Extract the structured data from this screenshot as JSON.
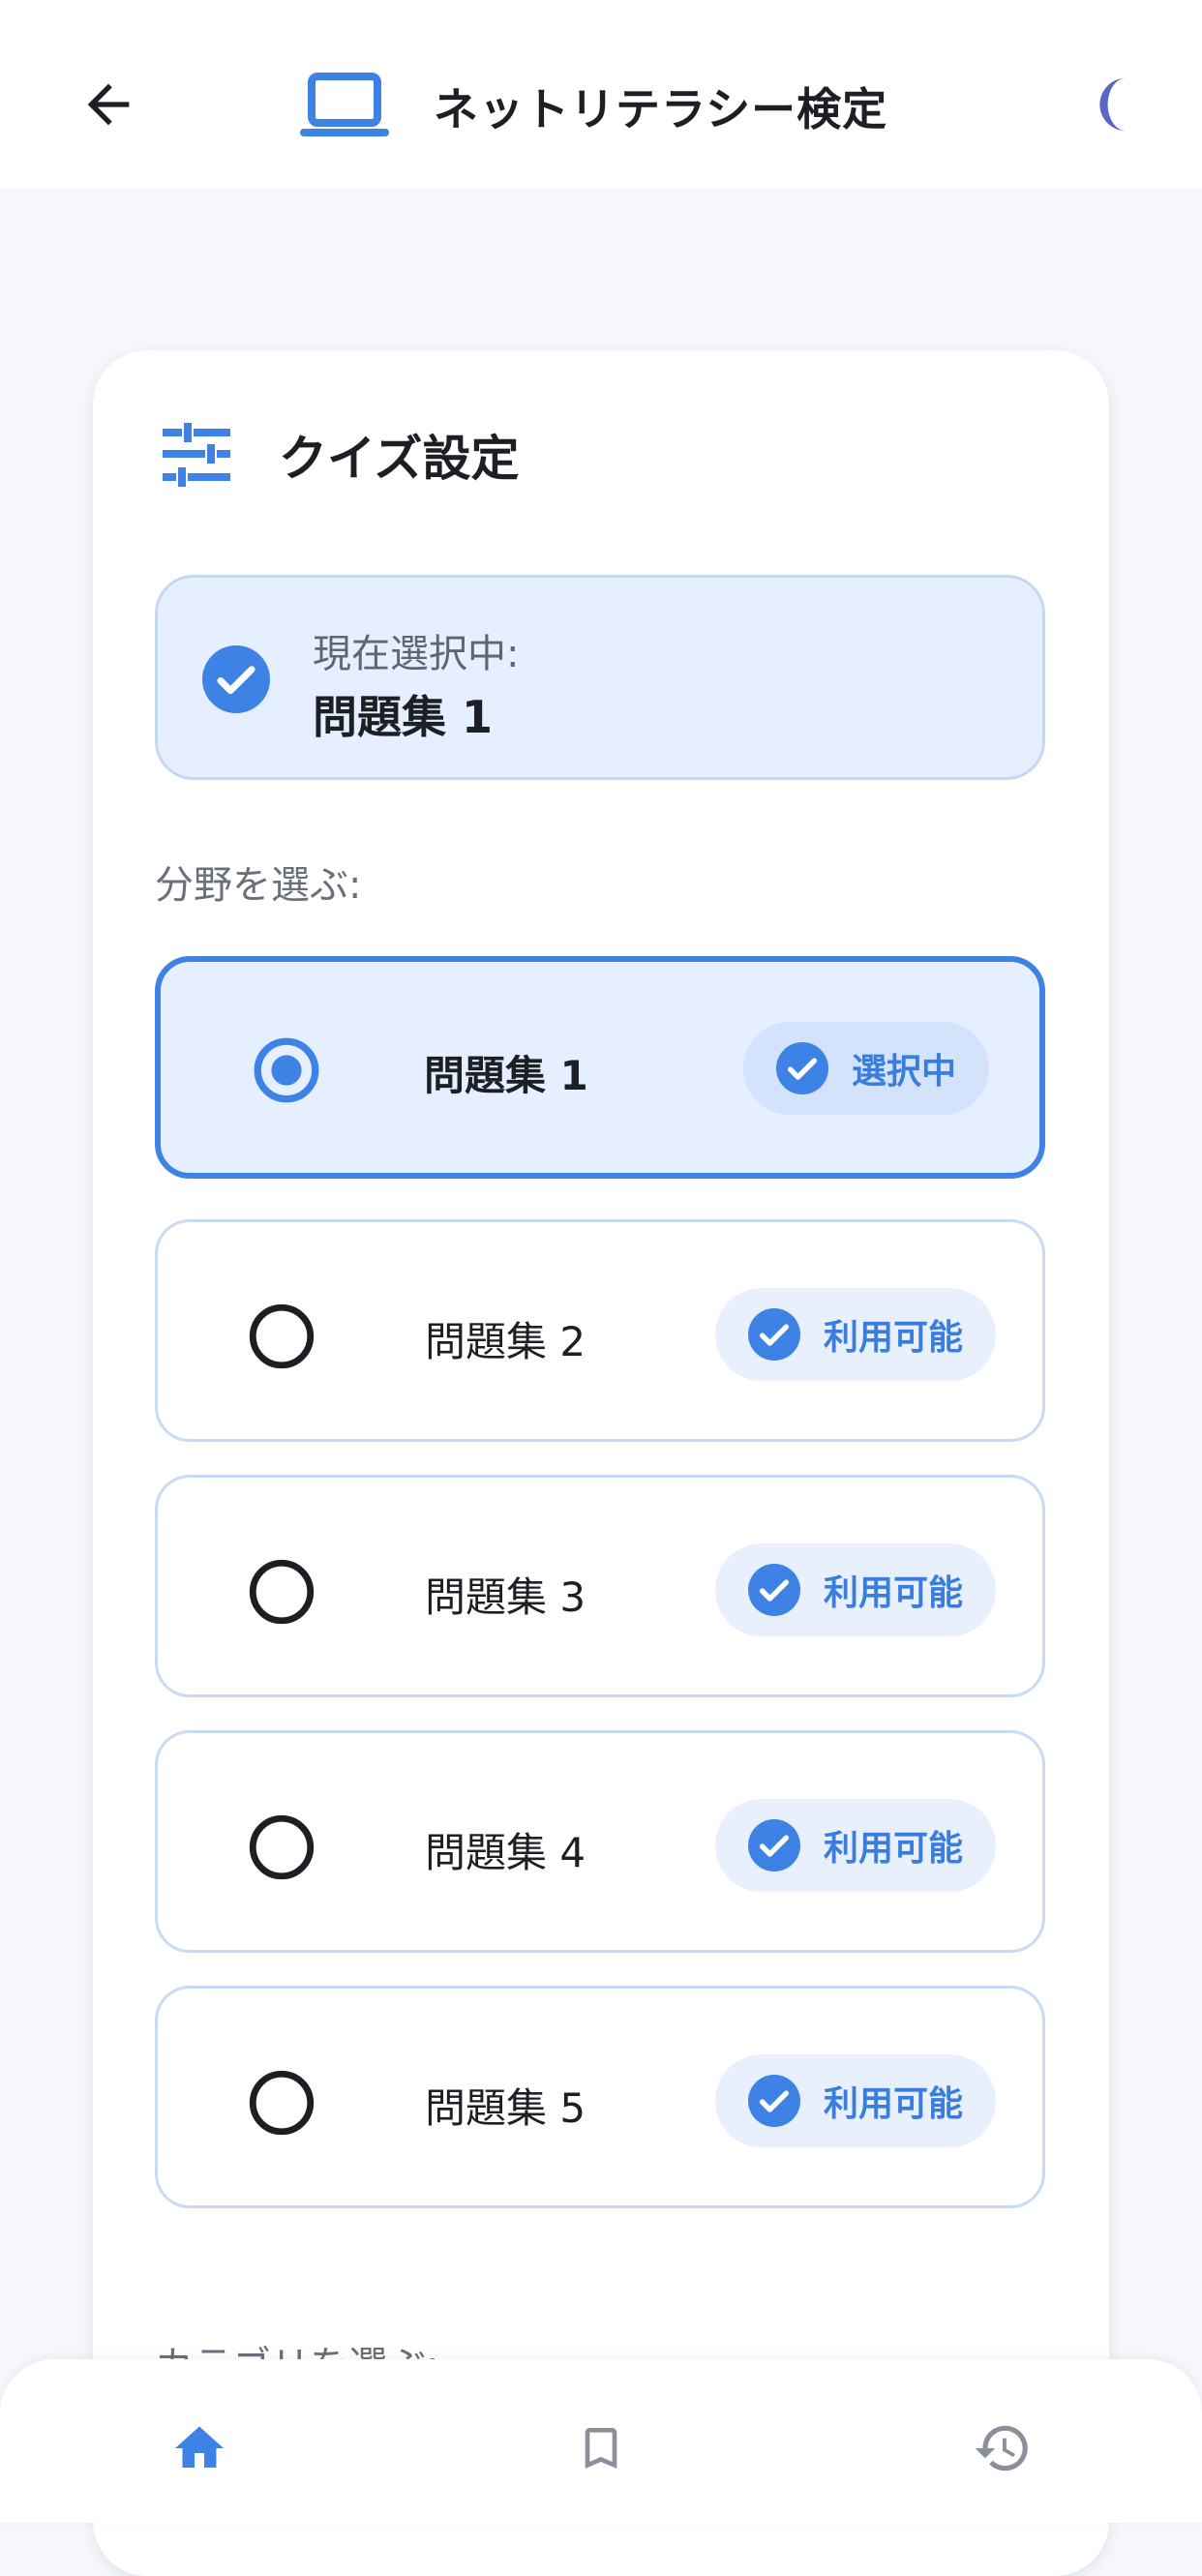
{
  "appbar": {
    "title": "ネットリテラシー検定"
  },
  "card": {
    "title": "クイズ設定",
    "current": {
      "label": "現在選択中:",
      "value": "問題集 1"
    },
    "section_label": "分野を選ぶ:",
    "options": [
      {
        "label": "問題集 1",
        "badge": "選択中",
        "selected": true
      },
      {
        "label": "問題集 2",
        "badge": "利用可能",
        "selected": false
      },
      {
        "label": "問題集 3",
        "badge": "利用可能",
        "selected": false
      },
      {
        "label": "問題集 4",
        "badge": "利用可能",
        "selected": false
      },
      {
        "label": "問題集 5",
        "badge": "利用可能",
        "selected": false
      }
    ],
    "next_section_partial": "カテゴリを選ぶ:"
  },
  "colors": {
    "accent": "#3f82e6",
    "moon": "#5868c4",
    "selected_bg": "#e6efff"
  },
  "icons": {
    "back": "arrow-left-icon",
    "app": "laptop-icon",
    "theme": "moon-icon",
    "settings": "tune-icon",
    "nav": [
      "home-icon",
      "bookmark-icon",
      "history-icon"
    ]
  }
}
